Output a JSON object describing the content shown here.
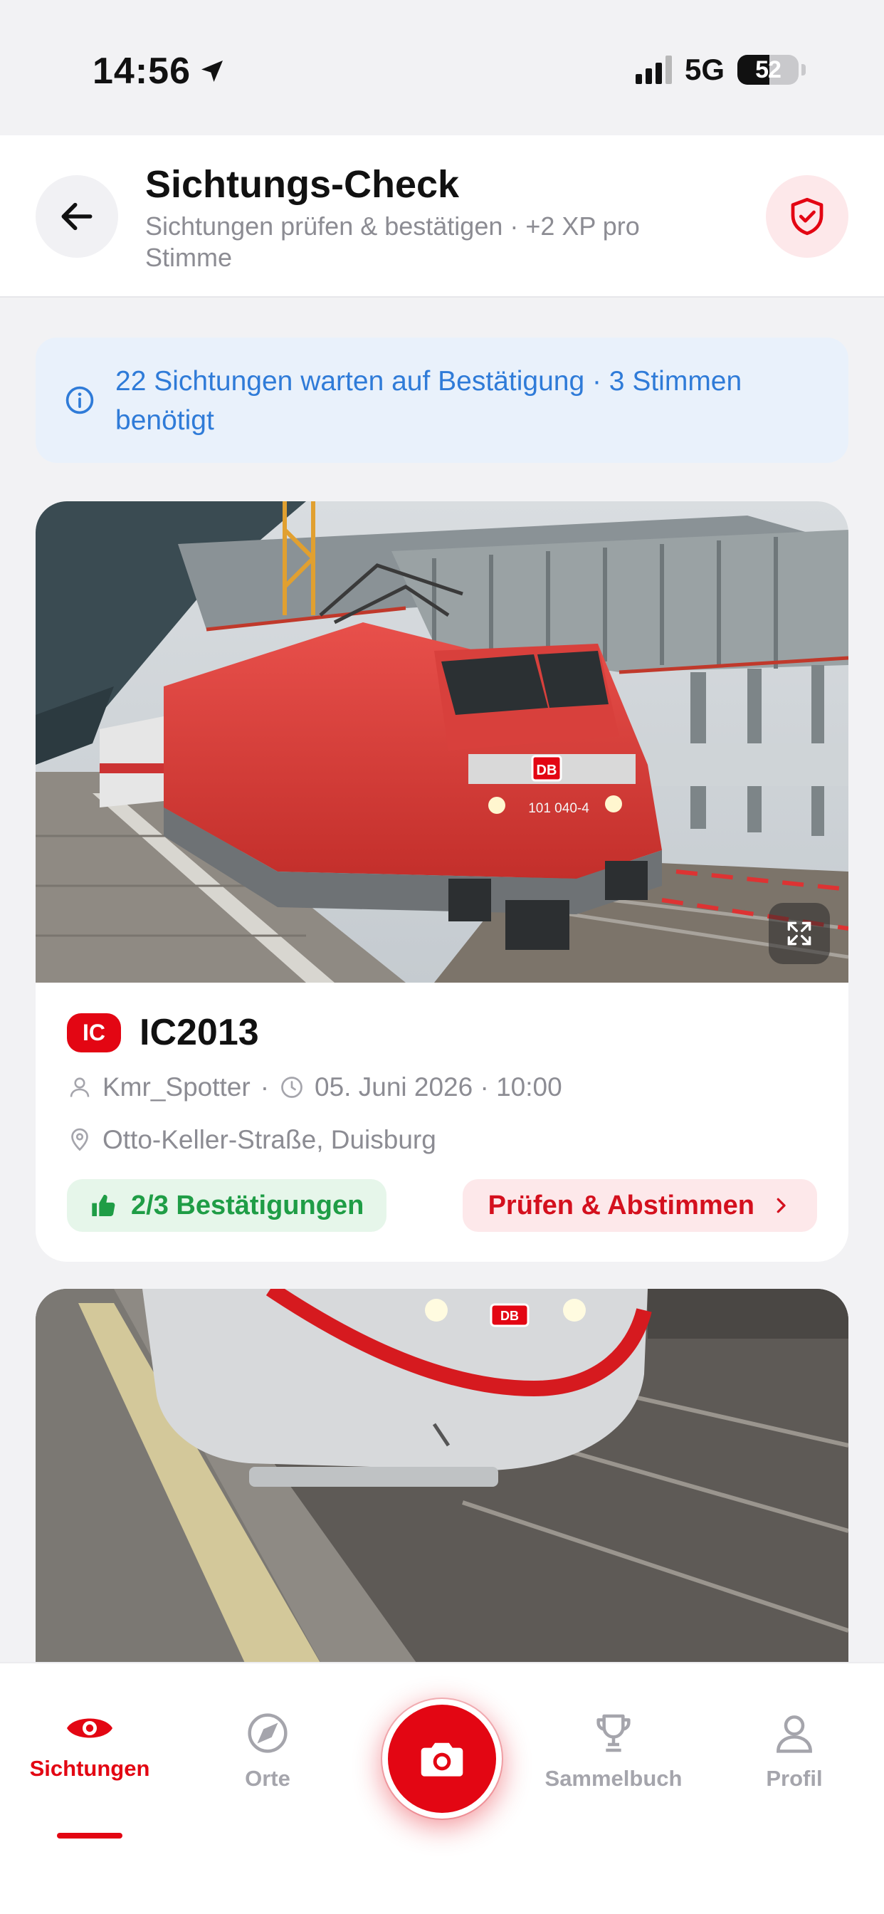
{
  "status_bar": {
    "time": "14:56",
    "network": "5G",
    "battery": "52"
  },
  "header": {
    "title": "Sichtungs-Check",
    "subtitle": "Sichtungen prüfen & bestätigen · +2 XP pro Stimme"
  },
  "info_banner": {
    "text": "22 Sichtungen warten auf Bestätigung · 3 Stimmen benötigt"
  },
  "cards": [
    {
      "type_badge": "IC",
      "title": "IC2013",
      "user": "Kmr_Spotter",
      "date": "05. Juni 2026 · 10:00",
      "location": "Otto-Keller-Straße, Duisburg",
      "confirmations": "2/3 Bestätigungen",
      "action_label": "Prüfen & Abstimmen",
      "locomotive_number": "101 040-4",
      "brand": "DB"
    },
    {
      "brand": "DB"
    }
  ],
  "bottom_nav": {
    "items": [
      {
        "label": "Sichtungen",
        "icon": "eye-icon",
        "active": true
      },
      {
        "label": "Orte",
        "icon": "compass-icon",
        "active": false
      },
      {
        "label": "Sammelbuch",
        "icon": "trophy-icon",
        "active": false
      },
      {
        "label": "Profil",
        "icon": "person-icon",
        "active": false
      }
    ],
    "camera": "camera-icon"
  },
  "colors": {
    "brand_red": "#e30613",
    "info_blue": "#2f7bd8",
    "success_green": "#1f9d46"
  }
}
